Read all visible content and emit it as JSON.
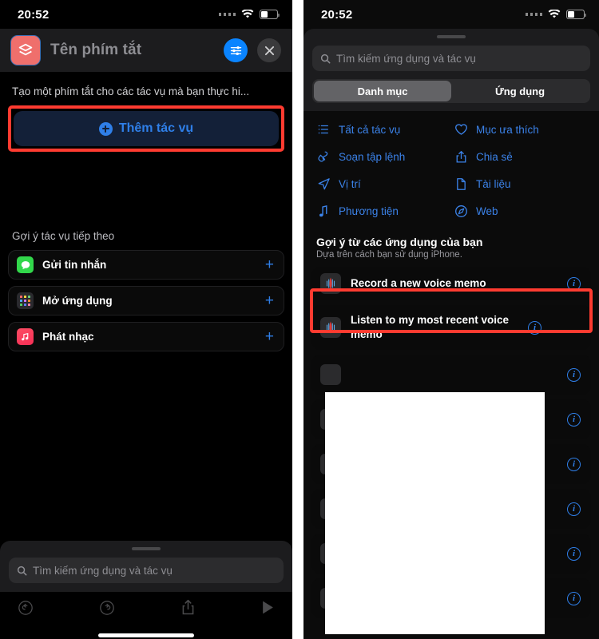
{
  "left_phone": {
    "status_bar": {
      "time": "20:52",
      "wifi_icon": "wifi-icon",
      "battery_icon": "battery-icon",
      "signal_icon": "signal-dots-icon"
    },
    "header": {
      "app_icon": "shortcuts-app-icon",
      "title": "Tên phím tắt",
      "settings_button": "sliders-icon",
      "close_button": "close-icon"
    },
    "description": "Tạo một phím tắt cho các tác vụ mà bạn thực hi...",
    "add_action": {
      "label": "Thêm tác vụ",
      "icon": "plus-circle-icon",
      "highlighted": true
    },
    "next_suggestions_title": "Gợi ý tác vụ tiếp theo",
    "suggestions": [
      {
        "label": "Gửi tin nhắn",
        "icon": "messages-app-icon",
        "action_icon": "plus-icon"
      },
      {
        "label": "Mở ứng dụng",
        "icon": "app-grid-icon",
        "action_icon": "plus-icon"
      },
      {
        "label": "Phát nhạc",
        "icon": "music-app-icon",
        "action_icon": "plus-icon"
      }
    ],
    "dock": {
      "search_placeholder": "Tìm kiếm ứng dụng và tác vụ",
      "search_icon": "search-icon",
      "toolbar": [
        {
          "name": "undo-button",
          "icon": "undo-icon"
        },
        {
          "name": "redo-button",
          "icon": "redo-icon"
        },
        {
          "name": "share-button",
          "icon": "share-icon"
        },
        {
          "name": "play-button",
          "icon": "play-icon"
        }
      ]
    }
  },
  "right_phone": {
    "status_bar": {
      "time": "20:52",
      "wifi_icon": "wifi-icon",
      "battery_icon": "battery-icon",
      "signal_icon": "signal-dots-icon"
    },
    "search": {
      "placeholder": "Tìm kiếm ứng dụng và tác vụ",
      "icon": "search-icon"
    },
    "segments": [
      {
        "label": "Danh mục",
        "active": true
      },
      {
        "label": "Ứng dụng",
        "active": false
      }
    ],
    "categories": [
      {
        "label": "Tất cả tác vụ",
        "icon": "list-bullet-icon"
      },
      {
        "label": "Mục ưa thích",
        "icon": "heart-icon"
      },
      {
        "label": "Soạn tập lệnh",
        "icon": "scripting-icon"
      },
      {
        "label": "Chia sẻ",
        "icon": "share-icon"
      },
      {
        "label": "Vị trí",
        "icon": "location-arrow-icon"
      },
      {
        "label": "Tài liệu",
        "icon": "document-icon"
      },
      {
        "label": "Phương tiện",
        "icon": "music-note-icon"
      },
      {
        "label": "Web",
        "icon": "safari-compass-icon"
      }
    ],
    "app_suggestions": {
      "title": "Gợi ý từ các ứng dụng của bạn",
      "subtitle": "Dựa trên cách bạn sử dụng iPhone.",
      "items": [
        {
          "label": "Record a new voice memo",
          "icon": "voice-memos-app-icon",
          "info_icon": "info-icon",
          "highlighted": true
        },
        {
          "label": "Listen to my most recent voice memo",
          "icon": "voice-memos-app-icon",
          "info_icon": "info-icon",
          "highlighted": false
        },
        {
          "label": "",
          "icon": "voice-memos-app-icon",
          "info_icon": "info-icon",
          "highlighted": false
        },
        {
          "label": "",
          "icon": "voice-memos-app-icon",
          "info_icon": "info-icon",
          "highlighted": false
        },
        {
          "label": "",
          "icon": "voice-memos-app-icon",
          "info_icon": "info-icon",
          "highlighted": false
        },
        {
          "label": "",
          "icon": "voice-memos-app-icon",
          "info_icon": "info-icon",
          "highlighted": false
        },
        {
          "label": "",
          "icon": "voice-memos-app-icon",
          "info_icon": "info-icon",
          "highlighted": false
        },
        {
          "label": "",
          "icon": "voice-memos-app-icon",
          "info_icon": "info-icon",
          "highlighted": false
        }
      ]
    }
  },
  "colors": {
    "accent_blue": "#0a84ff",
    "link_blue": "#3b82e8",
    "highlight_red": "#ff3b30",
    "panel_dark": "#1c1c1e",
    "background_black": "#000000"
  }
}
